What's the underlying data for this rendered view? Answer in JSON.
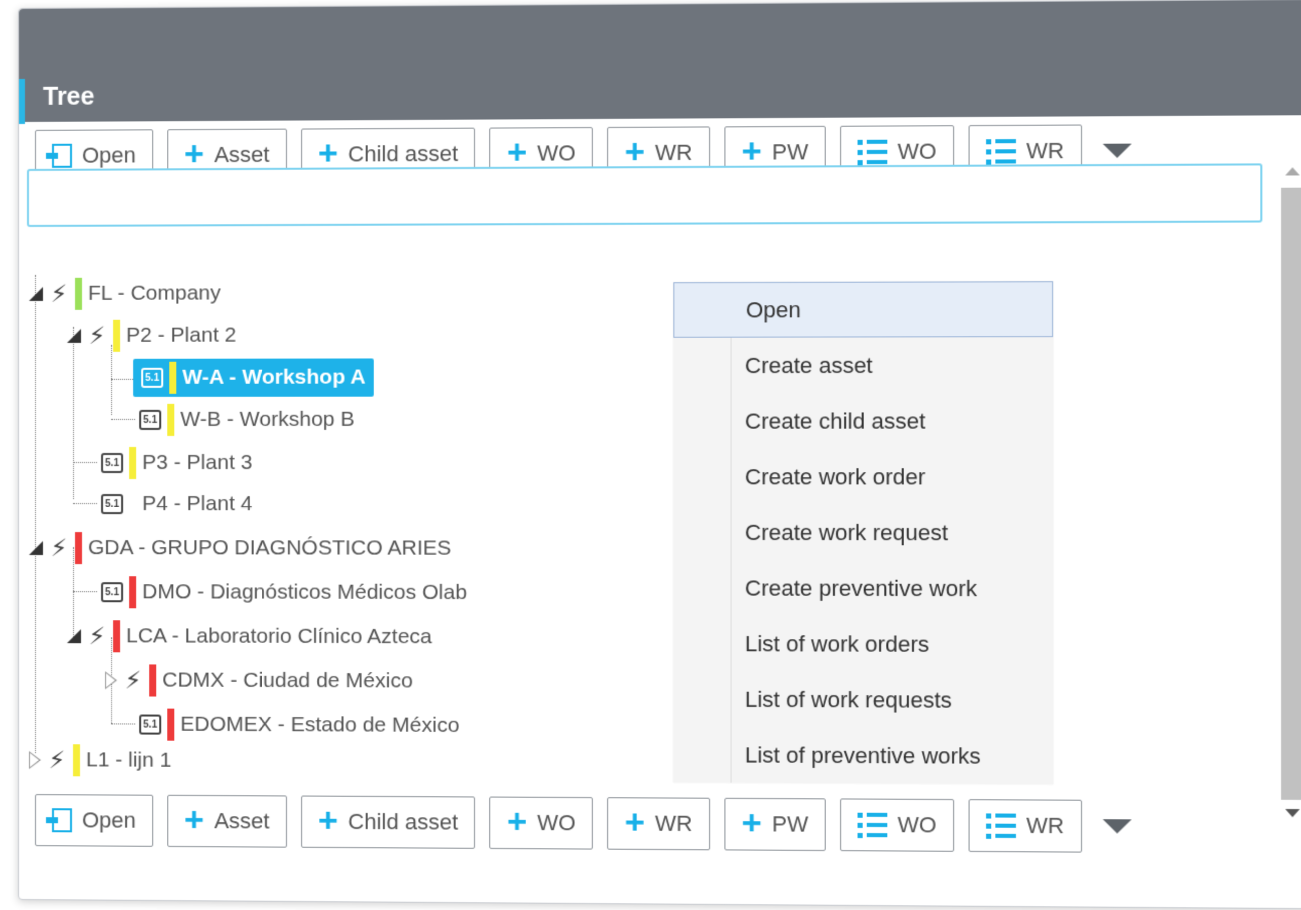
{
  "panel": {
    "title": "Tree"
  },
  "toolbar": {
    "buttons": [
      {
        "label": "Open",
        "icon": "open-icon"
      },
      {
        "label": "Asset",
        "icon": "plus-icon"
      },
      {
        "label": "Child asset",
        "icon": "plus-icon"
      },
      {
        "label": "WO",
        "icon": "plus-icon"
      },
      {
        "label": "WR",
        "icon": "plus-icon"
      },
      {
        "label": "PW",
        "icon": "plus-icon"
      },
      {
        "label": "WO",
        "icon": "list-icon"
      },
      {
        "label": "WR",
        "icon": "list-icon"
      }
    ]
  },
  "search": {
    "value": ""
  },
  "tree": {
    "nodes": [
      {
        "label": "FL - Company",
        "status_color": "#9be05a",
        "icon": "bolt-icon",
        "expanded": true
      },
      {
        "label": "P2 - Plant 2",
        "status_color": "#f6ee3a",
        "icon": "bolt-icon",
        "expanded": true
      },
      {
        "label": "W-A - Workshop A",
        "status_color": "#f6ee3a",
        "icon": "asset-badge-icon",
        "selected": true,
        "badge": "5.1"
      },
      {
        "label": "W-B - Workshop B",
        "status_color": "#f6ee3a",
        "icon": "asset-badge-icon",
        "badge": "5.1"
      },
      {
        "label": "P3 - Plant 3",
        "status_color": "#f6ee3a",
        "icon": "asset-badge-icon",
        "badge": "5.1"
      },
      {
        "label": "P4 - Plant 4",
        "status_color": "",
        "icon": "asset-badge-icon",
        "badge": "5.1"
      },
      {
        "label": "GDA - GRUPO DIAGNÓSTICO ARIES",
        "status_color": "#ee3b3b",
        "icon": "bolt-icon",
        "expanded": true
      },
      {
        "label": "DMO - Diagnósticos Médicos Olab",
        "status_color": "#ee3b3b",
        "icon": "asset-badge-icon",
        "badge": "5.1"
      },
      {
        "label": "LCA - Laboratorio Clínico Azteca",
        "status_color": "#ee3b3b",
        "icon": "bolt-icon",
        "expanded": true
      },
      {
        "label": "CDMX - Ciudad de México",
        "status_color": "#ee3b3b",
        "icon": "bolt-icon",
        "expanded": false
      },
      {
        "label": "EDOMEX - Estado de México",
        "status_color": "#ee3b3b",
        "icon": "asset-badge-icon",
        "badge": "5.1"
      },
      {
        "label": "L1 - lijn 1",
        "status_color": "#f6ee3a",
        "icon": "bolt-icon",
        "expanded": false
      }
    ]
  },
  "context_menu": {
    "items": [
      {
        "label": "Open",
        "hover": true
      },
      {
        "label": "Create asset"
      },
      {
        "label": "Create child asset"
      },
      {
        "label": "Create work order"
      },
      {
        "label": "Create work request"
      },
      {
        "label": "Create preventive work"
      },
      {
        "label": "List of work orders"
      },
      {
        "label": "List of work requests"
      },
      {
        "label": "List of preventive works"
      }
    ]
  },
  "colors": {
    "accent": "#1eb2e9",
    "header": "#6e747c"
  }
}
